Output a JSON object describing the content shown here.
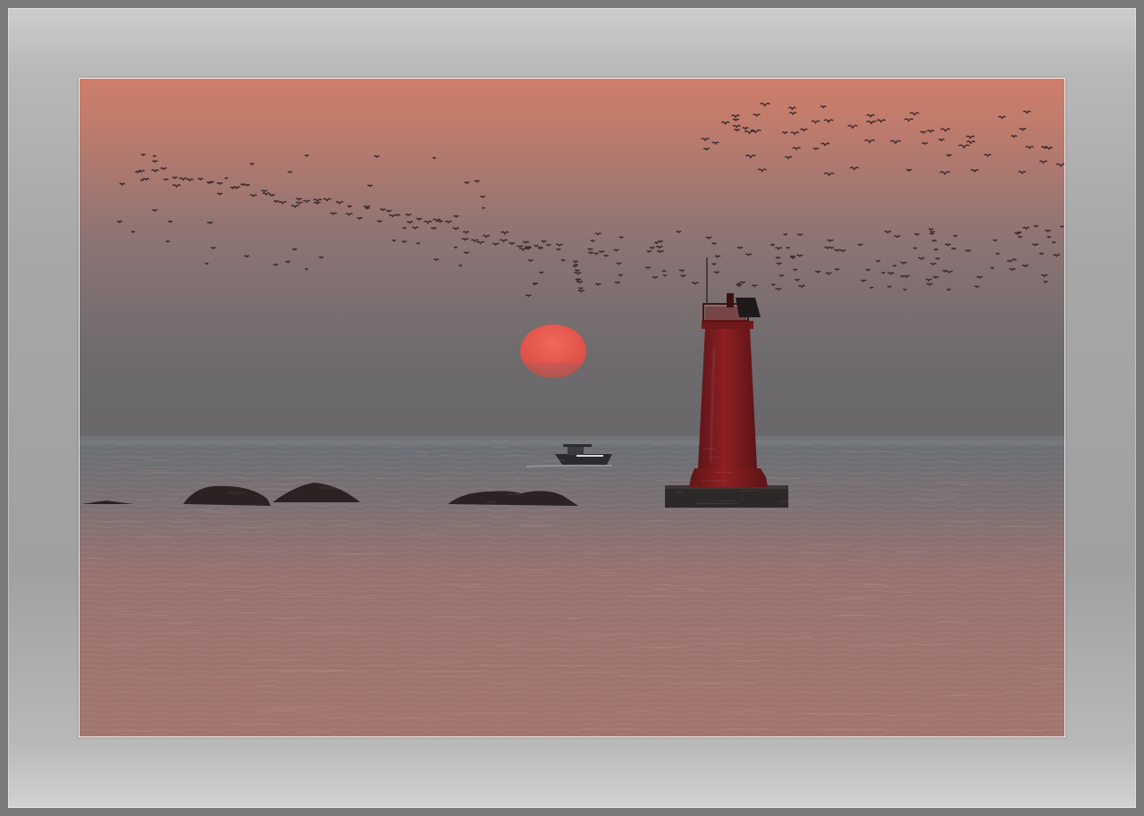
{
  "scene": {
    "subject": "sunset-over-sea-with-red-lighthouse",
    "colors": {
      "sky_top": "#d07e6a",
      "sky_mid": "#9a7674",
      "sky_horizon": "#6b6868",
      "sun": "#e0534a",
      "sea_far": "#6d6f73",
      "sea_near": "#a07470",
      "lighthouse": "#8a1c1f",
      "lighthouse_dark": "#3a1314",
      "rocks": "#2a2222",
      "frame_light": "#cdcdcd",
      "frame_dark": "#7a7a7a"
    },
    "elements": [
      "sun",
      "lighthouse",
      "boat",
      "rocks",
      "bird-flock",
      "sea-reflection"
    ]
  }
}
